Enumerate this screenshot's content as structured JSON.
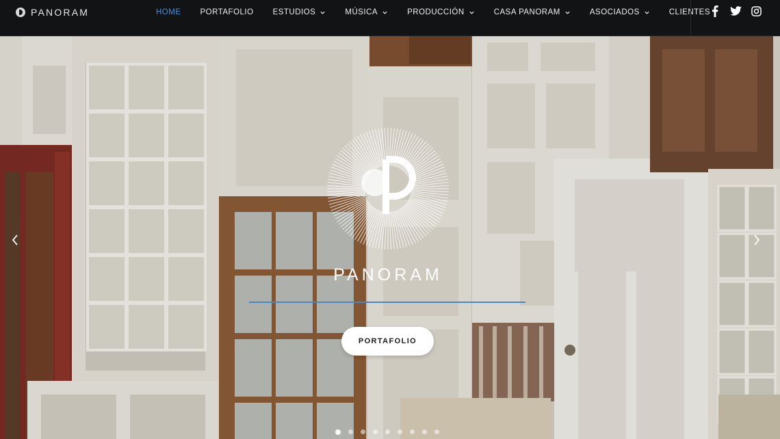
{
  "brand": {
    "logo_text": "PANORAM",
    "hero_title": "PANORAM"
  },
  "nav": {
    "items": [
      {
        "label": "HOME",
        "active": true,
        "dropdown": false
      },
      {
        "label": "PORTAFOLIO",
        "active": false,
        "dropdown": false
      },
      {
        "label": "ESTUDIOS",
        "active": false,
        "dropdown": true
      },
      {
        "label": "MÚSICA",
        "active": false,
        "dropdown": true
      },
      {
        "label": "PRODUCCIÓN",
        "active": false,
        "dropdown": true
      },
      {
        "label": "CASA PANORAM",
        "active": false,
        "dropdown": true
      },
      {
        "label": "ASOCIADOS",
        "active": false,
        "dropdown": true
      },
      {
        "label": "CLIENTES",
        "active": false,
        "dropdown": false
      }
    ],
    "social": [
      "facebook-icon",
      "twitter-icon",
      "instagram-icon"
    ]
  },
  "hero": {
    "cta_label": "PORTAFOLIO",
    "slides_total": 9,
    "active_slide": 1
  },
  "colors": {
    "nav_bg": "#121315",
    "accent": "#4a90d9",
    "underline": "#4a86c5",
    "button_bg": "#ffffff"
  }
}
